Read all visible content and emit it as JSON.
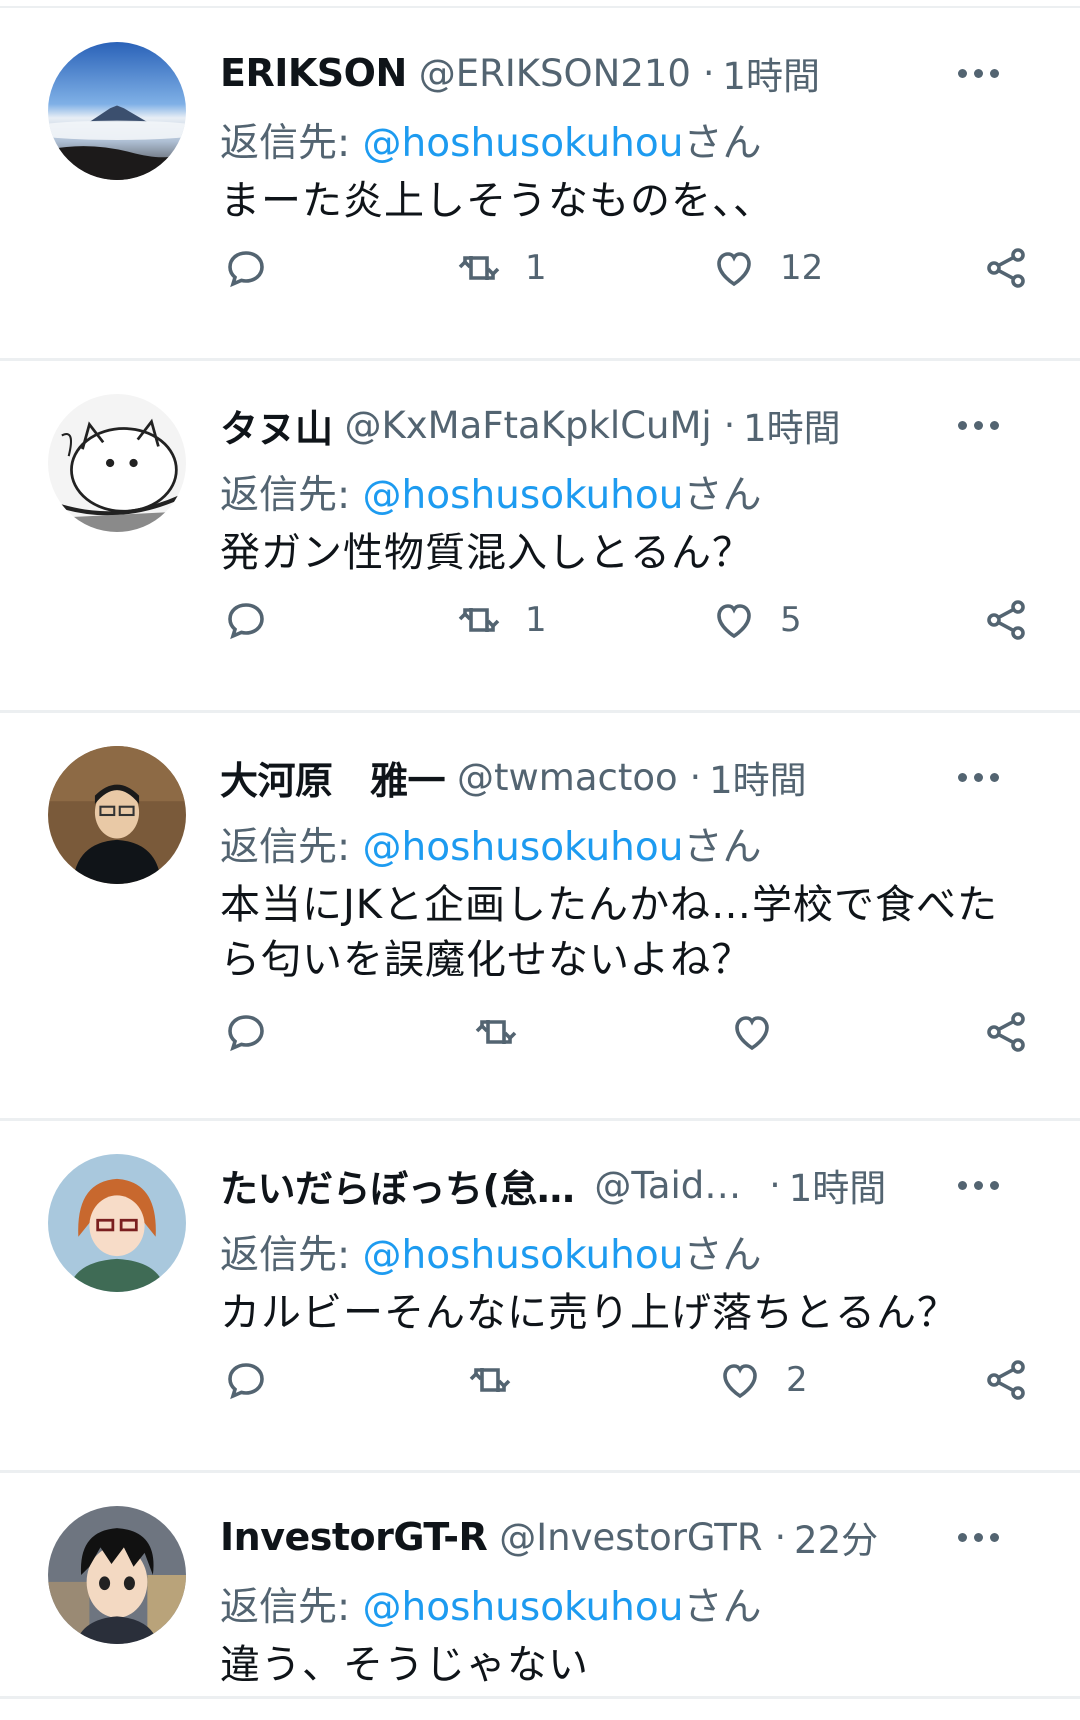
{
  "reply_prefix": "返信先: ",
  "reply_mention": "@hoshusokuhou",
  "reply_suffix": "さん",
  "colors": {
    "link": "#1d9bf0",
    "secondary": "#536471",
    "text": "#0f1419",
    "divider": "#eceff1"
  },
  "tweets": [
    {
      "name": "ERIKSON",
      "handle": "@ERIKSON210",
      "time": "1時間",
      "text": "まーた炎上しそうなものを、、",
      "retweets": "1",
      "likes": "12",
      "avatar": "mountain-sunrise"
    },
    {
      "name": "タヌ山",
      "handle": "@KxMaFtaKpklCuMj",
      "time": "1時間",
      "text": "発ガン性物質混入しとるん？",
      "retweets": "1",
      "likes": "5",
      "avatar": "manga-cat"
    },
    {
      "name": "大河原　雅一",
      "handle": "@twmactoo",
      "time": "1時間",
      "text": "本当にJKと企画したんかね…学校で食べたら匂いを誤魔化せないよね？",
      "retweets": "",
      "likes": "",
      "avatar": "man-photo"
    },
    {
      "name": "たいだらぼっち(怠…",
      "handle": "@Taid…",
      "time": "1時間",
      "text": "カルビーそんなに売り上げ落ちとるん？",
      "retweets": "",
      "likes": "2",
      "avatar": "anime-girl"
    },
    {
      "name": "InvestorGT-R",
      "handle": "@InvestorGTR",
      "time": "22分",
      "text": "違う、そうじゃない",
      "retweets": "",
      "likes": "",
      "avatar": "anime-boy"
    }
  ]
}
